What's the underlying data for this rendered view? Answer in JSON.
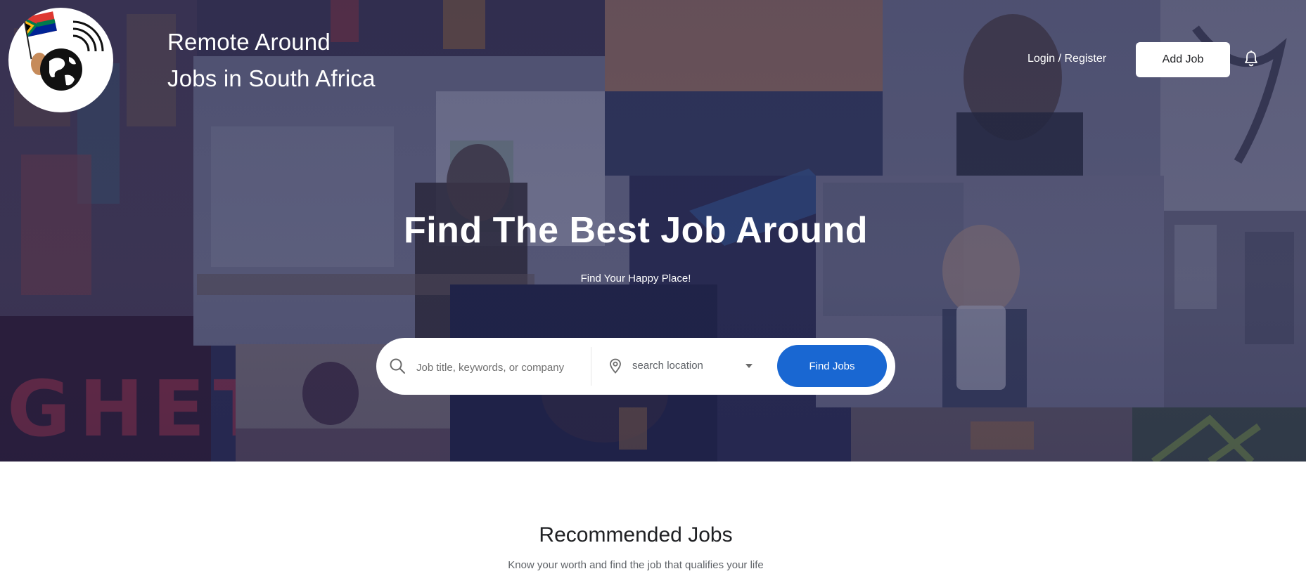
{
  "header": {
    "brand_line1": "Remote Around",
    "brand_line2": "Jobs in South Africa",
    "login_label": "Login / Register",
    "add_job_label": "Add Job",
    "bell_icon": "bell-icon",
    "logo_icon": "globe-flag-logo"
  },
  "hero": {
    "headline": "Find The Best Job Around",
    "subline": "Find Your Happy Place!"
  },
  "search": {
    "keyword_placeholder": "Job title, keywords, or company",
    "keyword_value": "",
    "location_value": "search location",
    "find_button_label": "Find Jobs",
    "search_icon": "search-icon",
    "location_icon": "map-pin-icon",
    "dropdown_icon": "caret-down-icon"
  },
  "recommended": {
    "title": "Recommended Jobs",
    "subtitle": "Know your worth and find the job that qualifies your life"
  },
  "colors": {
    "accent": "#1967d2",
    "hero_overlay": "#1c1e48",
    "text_dark": "#202124"
  }
}
